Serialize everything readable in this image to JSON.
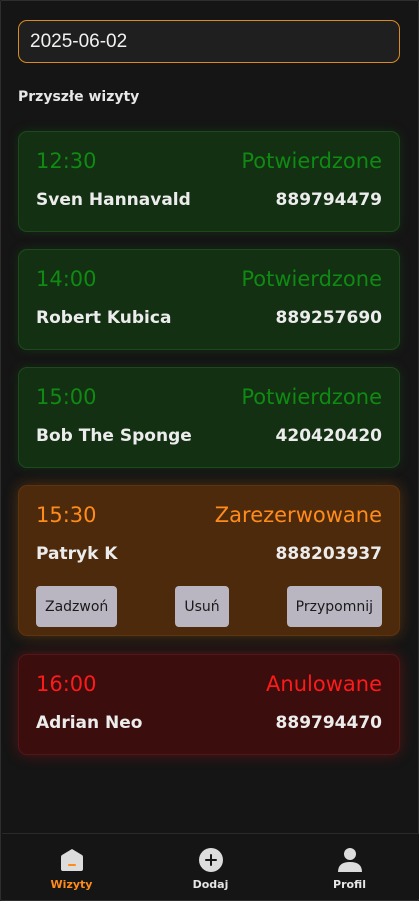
{
  "date_field": {
    "value": "2025-06-02"
  },
  "section_title": "Przyszłe wizyty",
  "appointments": [
    {
      "time": "12:30",
      "status": "Potwierdzone",
      "name": "Sven Hannavald",
      "phone": "889794479"
    },
    {
      "time": "14:00",
      "status": "Potwierdzone",
      "name": "Robert Kubica",
      "phone": "889257690"
    },
    {
      "time": "15:00",
      "status": "Potwierdzone",
      "name": "Bob The Sponge",
      "phone": "420420420"
    },
    {
      "time": "15:30",
      "status": "Zarezerwowane",
      "name": "Patryk K",
      "phone": "888203937",
      "actions": {
        "call": "Zadzwoń",
        "delete": "Usuń",
        "remind": "Przypomnij"
      }
    },
    {
      "time": "16:00",
      "status": "Anulowane",
      "name": "Adrian Neo",
      "phone": "889794470"
    }
  ],
  "status_colors": {
    "confirmed": "#0f8a12",
    "reserved": "#ff8c1a",
    "cancelled": "#ff1a1a"
  },
  "accent_color": "#d98a22",
  "tabbar": {
    "items": [
      {
        "label": "Wizyty",
        "icon": "home-icon",
        "active": true
      },
      {
        "label": "Dodaj",
        "icon": "plus-circle-icon",
        "active": false
      },
      {
        "label": "Profil",
        "icon": "person-icon",
        "active": false
      }
    ]
  }
}
